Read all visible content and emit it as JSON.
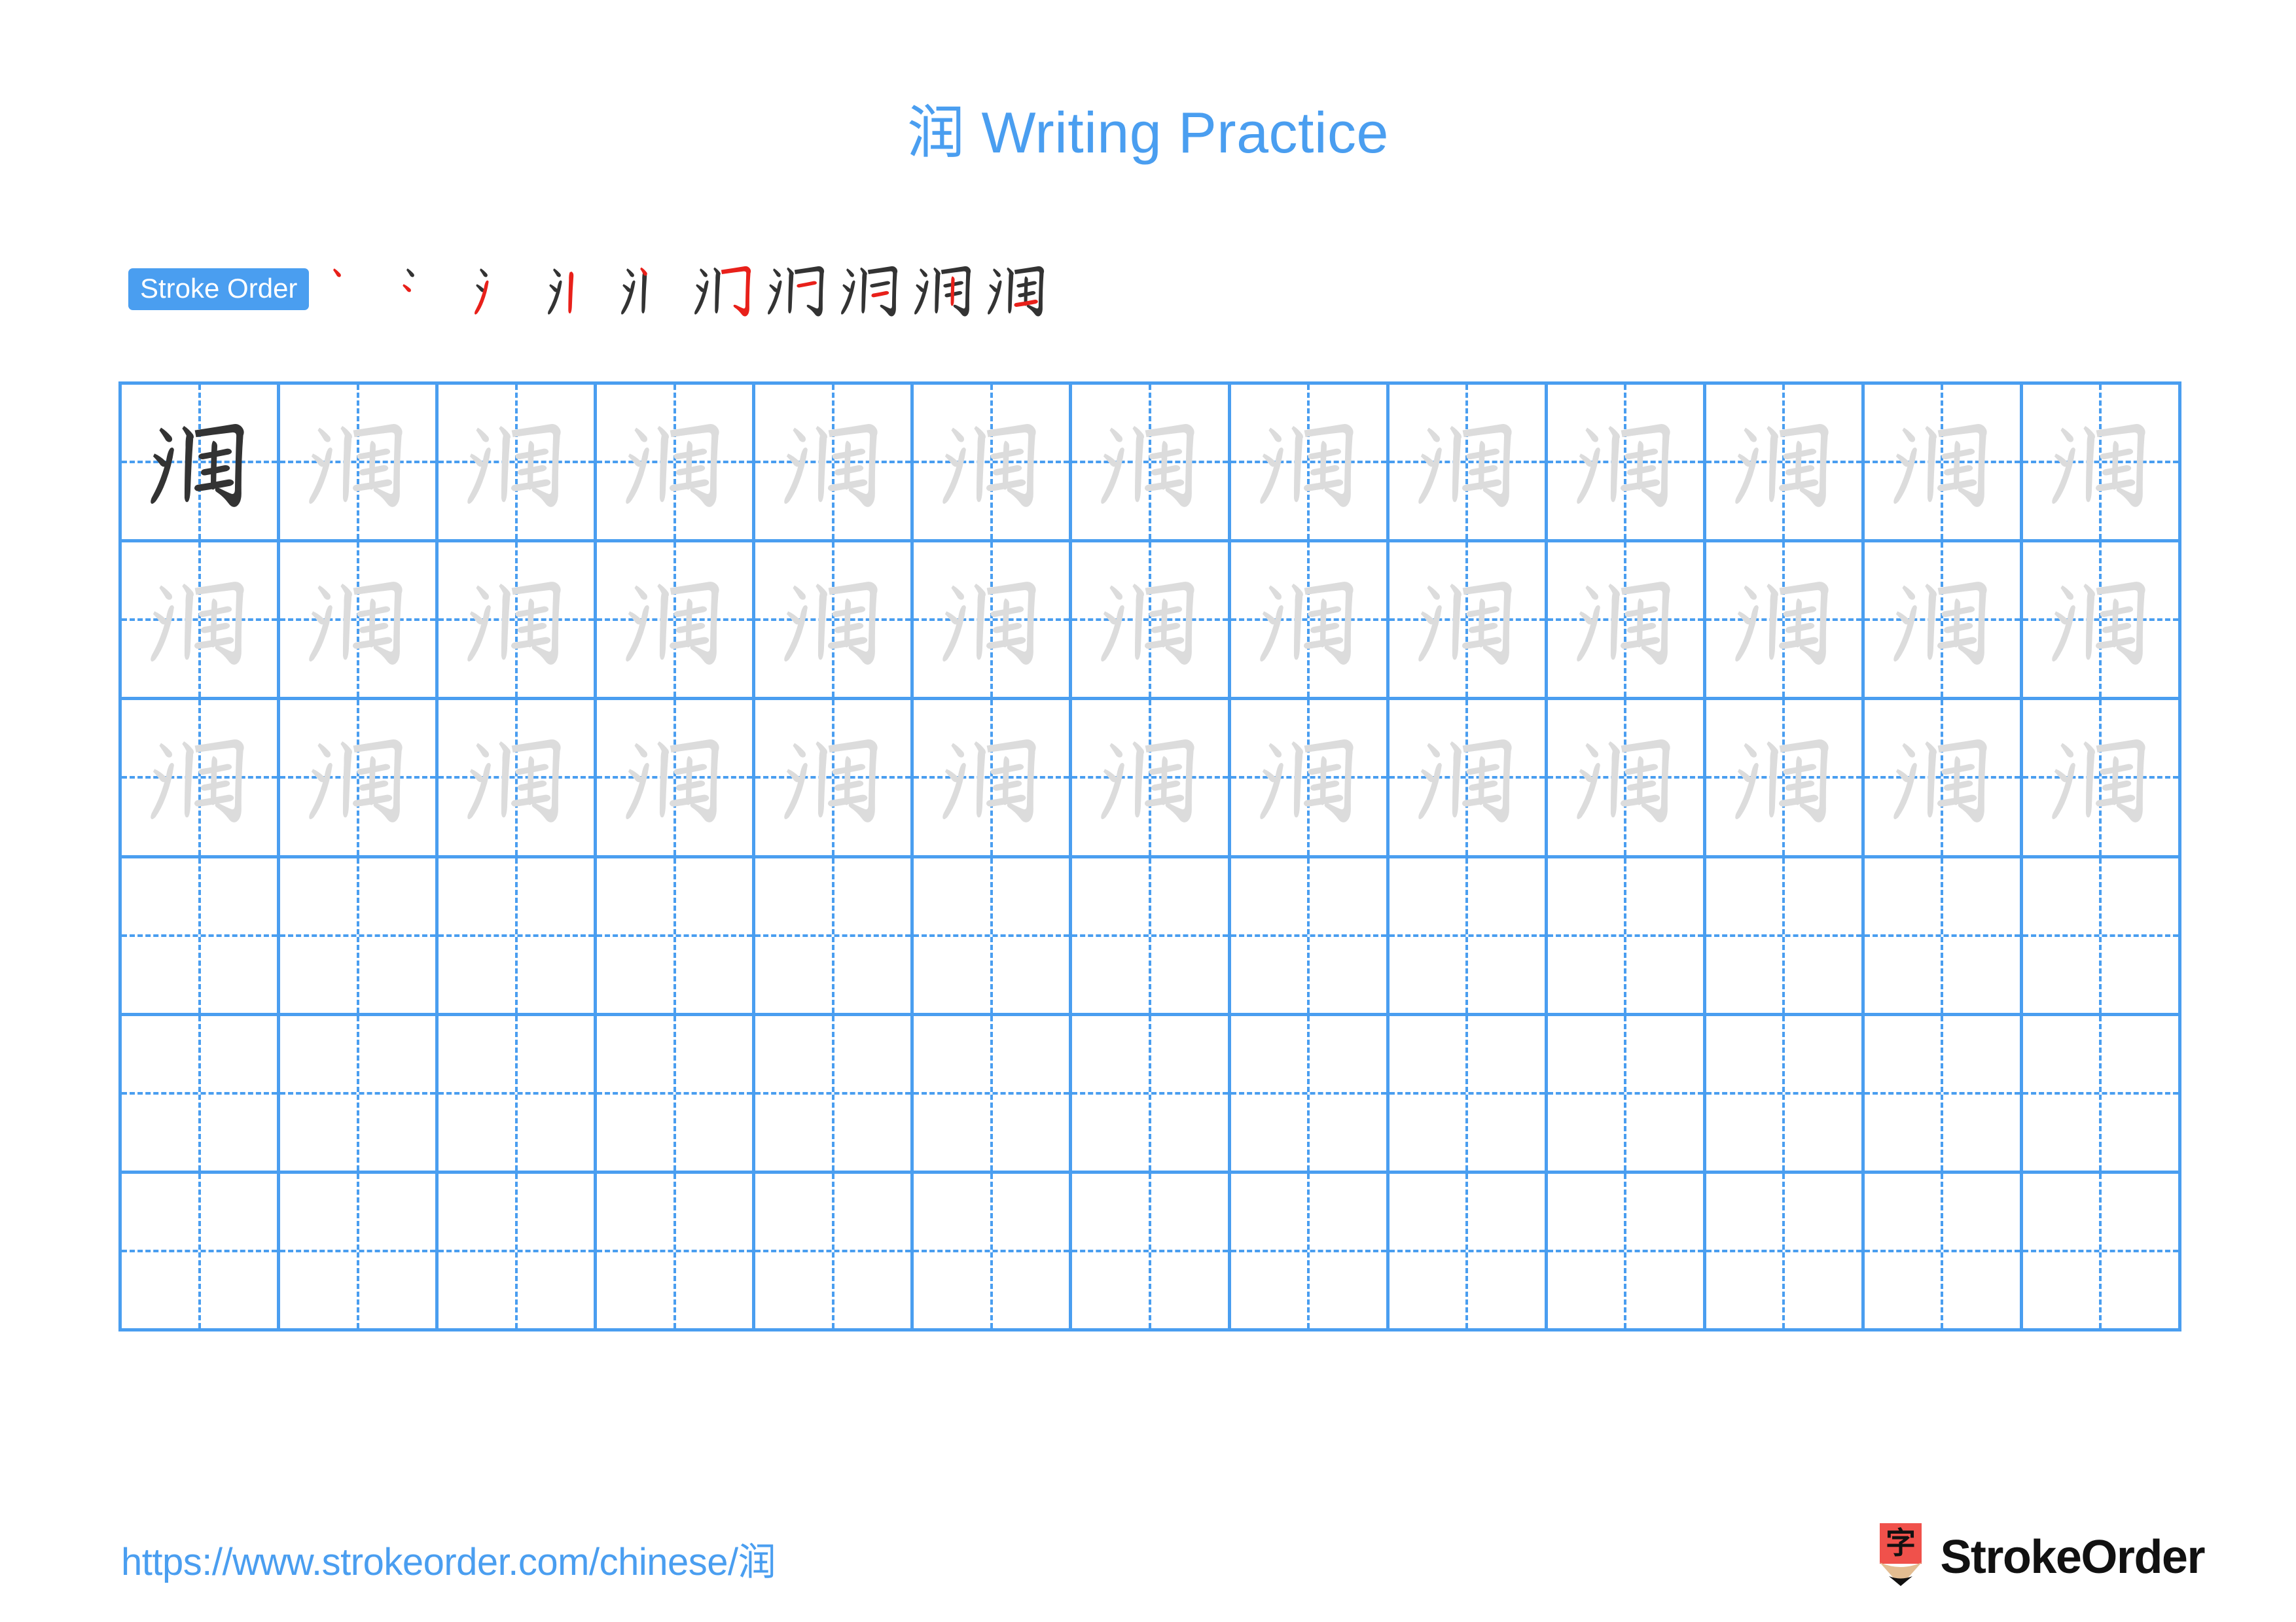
{
  "page": {
    "character": "润",
    "title": "润 Writing Practice",
    "title_character": "润",
    "title_text": " Writing Practice",
    "accent_color": "#4a9ef0",
    "stroke_highlight_color": "#e8201a",
    "trace_color": "#dcdcdc",
    "ink_color": "#333333",
    "background_color": "#ffffff"
  },
  "stroke_order": {
    "label": "Stroke Order",
    "total_strokes": 10,
    "steps": [
      {
        "index": 1,
        "strokes_shown": 1,
        "new_stroke": 1,
        "name": "dian"
      },
      {
        "index": 2,
        "strokes_shown": 2,
        "new_stroke": 2,
        "name": "dian"
      },
      {
        "index": 3,
        "strokes_shown": 3,
        "new_stroke": 3,
        "name": "ti"
      },
      {
        "index": 4,
        "strokes_shown": 4,
        "new_stroke": 4,
        "name": "shu"
      },
      {
        "index": 5,
        "strokes_shown": 5,
        "new_stroke": 5,
        "name": "shu"
      },
      {
        "index": 6,
        "strokes_shown": 6,
        "new_stroke": 6,
        "name": "hengzhegou"
      },
      {
        "index": 7,
        "strokes_shown": 7,
        "new_stroke": 7,
        "name": "heng"
      },
      {
        "index": 8,
        "strokes_shown": 8,
        "new_stroke": 8,
        "name": "heng"
      },
      {
        "index": 9,
        "strokes_shown": 9,
        "new_stroke": 9,
        "name": "shu"
      },
      {
        "index": 10,
        "strokes_shown": 10,
        "new_stroke": 10,
        "name": "heng"
      }
    ]
  },
  "practice_grid": {
    "columns": 13,
    "rows": 6,
    "cells": [
      [
        "ink",
        "trace",
        "trace",
        "trace",
        "trace",
        "trace",
        "trace",
        "trace",
        "trace",
        "trace",
        "trace",
        "trace",
        "trace"
      ],
      [
        "trace",
        "trace",
        "trace",
        "trace",
        "trace",
        "trace",
        "trace",
        "trace",
        "trace",
        "trace",
        "trace",
        "trace",
        "trace"
      ],
      [
        "trace",
        "trace",
        "trace",
        "trace",
        "trace",
        "trace",
        "trace",
        "trace",
        "trace",
        "trace",
        "trace",
        "trace",
        "trace"
      ],
      [
        "empty",
        "empty",
        "empty",
        "empty",
        "empty",
        "empty",
        "empty",
        "empty",
        "empty",
        "empty",
        "empty",
        "empty",
        "empty"
      ],
      [
        "empty",
        "empty",
        "empty",
        "empty",
        "empty",
        "empty",
        "empty",
        "empty",
        "empty",
        "empty",
        "empty",
        "empty",
        "empty"
      ],
      [
        "empty",
        "empty",
        "empty",
        "empty",
        "empty",
        "empty",
        "empty",
        "empty",
        "empty",
        "empty",
        "empty",
        "empty",
        "empty"
      ]
    ]
  },
  "footer": {
    "url": "https://www.strokeorder.com/chinese/润",
    "url_prefix": "https://www.strokeorder.com/chinese/",
    "url_character": "润",
    "brand_name": "StrokeOrder",
    "logo_character": "字",
    "logo_body_color": "#f0514b",
    "logo_wood_color": "#e3bd91",
    "logo_tip_color": "#111111"
  }
}
